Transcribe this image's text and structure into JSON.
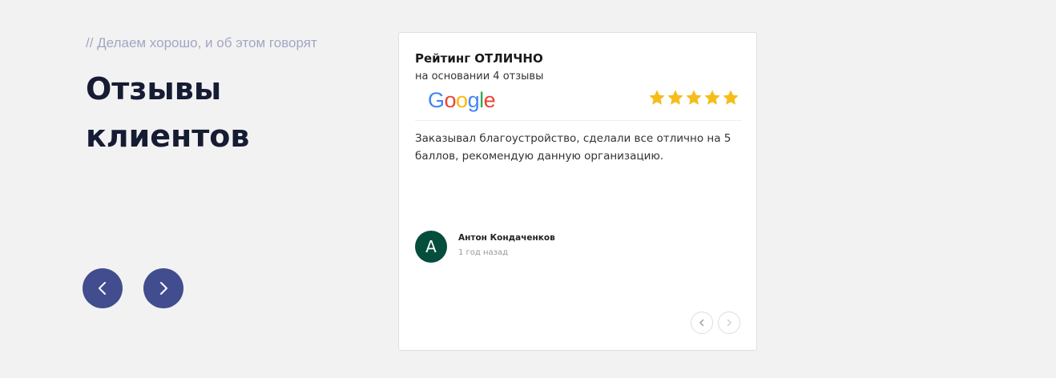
{
  "section": {
    "subtitle": "// Делаем хорошо, и об этом говорят",
    "heading": "Отзывы клиентов"
  },
  "carousel_nav": {
    "prev_icon": "chevron-left-icon",
    "next_icon": "chevron-right-icon",
    "button_color": "#424d8f"
  },
  "review_card": {
    "rating_title": "Рейтинг ОТЛИЧНО",
    "rating_basis": "на основании 4 отзывы",
    "source_logo": "Google",
    "rating_stars": 5,
    "star_color": "#f5bd1b",
    "review": {
      "text": "Заказывал благоустройство, сделали все отлично на 5 баллов, рекомендую данную организацию.",
      "author_initial": "А",
      "author_name": "Антон Кондаченков",
      "date": "1 год назад",
      "avatar_color": "#054d3c"
    },
    "mini_nav": {
      "prev_icon": "chevron-left-icon",
      "next_icon": "chevron-right-icon"
    }
  }
}
